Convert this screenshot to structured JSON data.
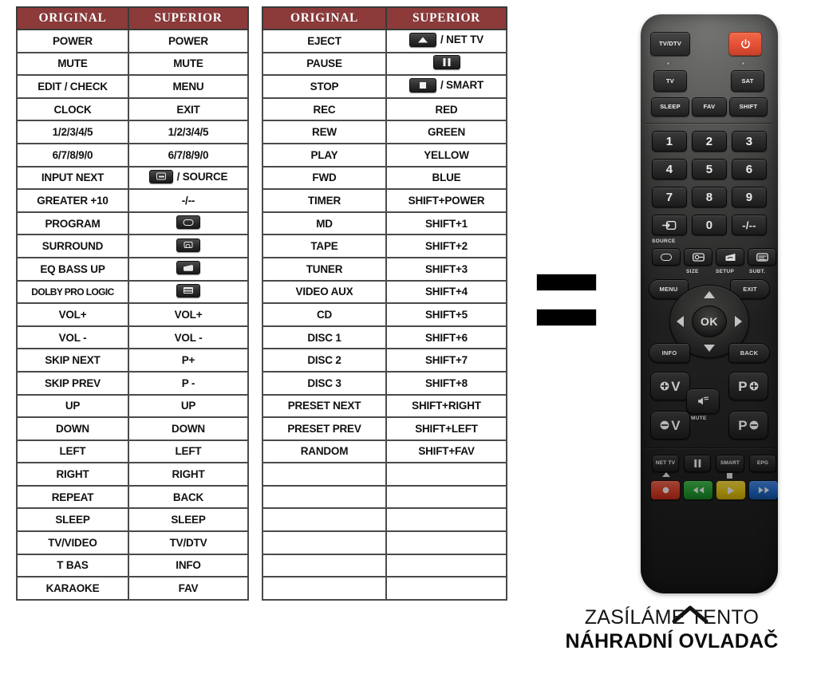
{
  "tables": [
    {
      "id": "table-original-superior-1",
      "headers": [
        "ORIGINAL",
        "SUPERIOR"
      ],
      "rows": [
        {
          "original": "POWER",
          "superior": "POWER"
        },
        {
          "original": "MUTE",
          "superior": "MUTE"
        },
        {
          "original": "EDIT / CHECK",
          "superior": "MENU"
        },
        {
          "original": "CLOCK",
          "superior": "EXIT"
        },
        {
          "original": "1/2/3/4/5",
          "superior": "1/2/3/4/5"
        },
        {
          "original": "6/7/8/9/0",
          "superior": "6/7/8/9/0"
        },
        {
          "original": "INPUT NEXT",
          "superior": "/ SOURCE",
          "icon": "source-icon"
        },
        {
          "original": "GREATER +10",
          "superior": "-/--"
        },
        {
          "original": "PROGRAM",
          "superior": "",
          "icon": "screen-format-icon"
        },
        {
          "original": "SURROUND",
          "superior": "",
          "icon": "size-icon"
        },
        {
          "original": "EQ BASS UP",
          "superior": "",
          "icon": "setup-icon"
        },
        {
          "original": "DOLBY PRO LOGIC",
          "superior": "",
          "icon": "subtitle-icon"
        },
        {
          "original": "VOL+",
          "superior": "VOL+"
        },
        {
          "original": "VOL -",
          "superior": "VOL -"
        },
        {
          "original": "SKIP NEXT",
          "superior": "P+"
        },
        {
          "original": "SKIP PREV",
          "superior": "P -"
        },
        {
          "original": "UP",
          "superior": "UP"
        },
        {
          "original": "DOWN",
          "superior": "DOWN"
        },
        {
          "original": "LEFT",
          "superior": "LEFT"
        },
        {
          "original": "RIGHT",
          "superior": "RIGHT"
        },
        {
          "original": "REPEAT",
          "superior": "BACK"
        },
        {
          "original": "SLEEP",
          "superior": "SLEEP"
        },
        {
          "original": "TV/VIDEO",
          "superior": "TV/DTV"
        },
        {
          "original": "T BAS",
          "superior": "INFO"
        },
        {
          "original": "KARAOKE",
          "superior": "FAV"
        }
      ]
    },
    {
      "id": "table-original-superior-2",
      "headers": [
        "ORIGINAL",
        "SUPERIOR"
      ],
      "rows": [
        {
          "original": "EJECT",
          "superior": "/ NET TV",
          "icon": "eject-triangle-icon"
        },
        {
          "original": "PAUSE",
          "superior": "",
          "icon": "pause-icon"
        },
        {
          "original": "STOP",
          "superior": "/ SMART",
          "icon": "stop-icon"
        },
        {
          "original": "REC",
          "superior": "RED"
        },
        {
          "original": "REW",
          "superior": "GREEN"
        },
        {
          "original": "PLAY",
          "superior": "YELLOW"
        },
        {
          "original": "FWD",
          "superior": "BLUE"
        },
        {
          "original": "TIMER",
          "superior": "SHIFT+POWER"
        },
        {
          "original": "MD",
          "superior": "SHIFT+1"
        },
        {
          "original": "TAPE",
          "superior": "SHIFT+2"
        },
        {
          "original": "TUNER",
          "superior": "SHIFT+3"
        },
        {
          "original": "VIDEO AUX",
          "superior": "SHIFT+4"
        },
        {
          "original": "CD",
          "superior": "SHIFT+5"
        },
        {
          "original": "DISC 1",
          "superior": "SHIFT+6"
        },
        {
          "original": "DISC 2",
          "superior": "SHIFT+7"
        },
        {
          "original": "DISC 3",
          "superior": "SHIFT+8"
        },
        {
          "original": "PRESET NEXT",
          "superior": "SHIFT+RIGHT"
        },
        {
          "original": "PRESET PREV",
          "superior": "SHIFT+LEFT"
        },
        {
          "original": "RANDOM",
          "superior": "SHIFT+FAV"
        },
        {
          "original": "",
          "superior": ""
        },
        {
          "original": "",
          "superior": ""
        },
        {
          "original": "",
          "superior": ""
        },
        {
          "original": "",
          "superior": ""
        },
        {
          "original": "",
          "superior": ""
        },
        {
          "original": "",
          "superior": ""
        }
      ]
    }
  ],
  "equals_sign": {
    "name": "equals-sign",
    "bars": 2,
    "color": "#000000"
  },
  "remote": {
    "name": "replacement-remote-control",
    "body_color": "#2b2b2b",
    "buttons": {
      "tvdtv": "TV/DTV",
      "power": "power-icon",
      "tv": "TV",
      "sat": "SAT",
      "sleep": "SLEEP",
      "fav": "FAV",
      "shift": "SHIFT",
      "n1": "1",
      "n2": "2",
      "n3": "3",
      "n4": "4",
      "n5": "5",
      "n6": "6",
      "n7": "7",
      "n8": "8",
      "n9": "9",
      "source": "source-icon",
      "n0": "0",
      "dash": "-/--",
      "source_label": "SOURCE",
      "screen_format": "screen-format-icon",
      "size": "size-icon",
      "setup": "setup-icon",
      "subt": "subtitle-icon",
      "size_label": "SIZE",
      "setup_label": "SETUP",
      "subt_label": "SUBT.",
      "menu": "MENU",
      "exit": "EXIT",
      "ok": "OK",
      "up": "up-arrow-icon",
      "down": "down-arrow-icon",
      "left": "left-arrow-icon",
      "right": "right-arrow-icon",
      "info": "INFO",
      "back": "BACK",
      "vol_up": "V",
      "vol_down": "V",
      "prog_up": "P",
      "prog_down": "P",
      "mute": "mute-icon",
      "mute_label": "MUTE",
      "net_tv": "NET TV",
      "pause": "pause-icon",
      "smart": "SMART",
      "epg": "EPG",
      "rec": "record-icon",
      "rew": "rewind-icon",
      "play": "play-icon",
      "fwd": "fast-forward-icon"
    },
    "color_keys": {
      "red": "#e8412b",
      "green": "#23a633",
      "yellow": "#f2cf12",
      "blue": "#1f6fd6"
    }
  },
  "caption": {
    "caret": "caret-up-icon",
    "line1": "ZASÍLÁME TENTO",
    "line2": "NÁHRADNÍ OVLADAČ"
  }
}
